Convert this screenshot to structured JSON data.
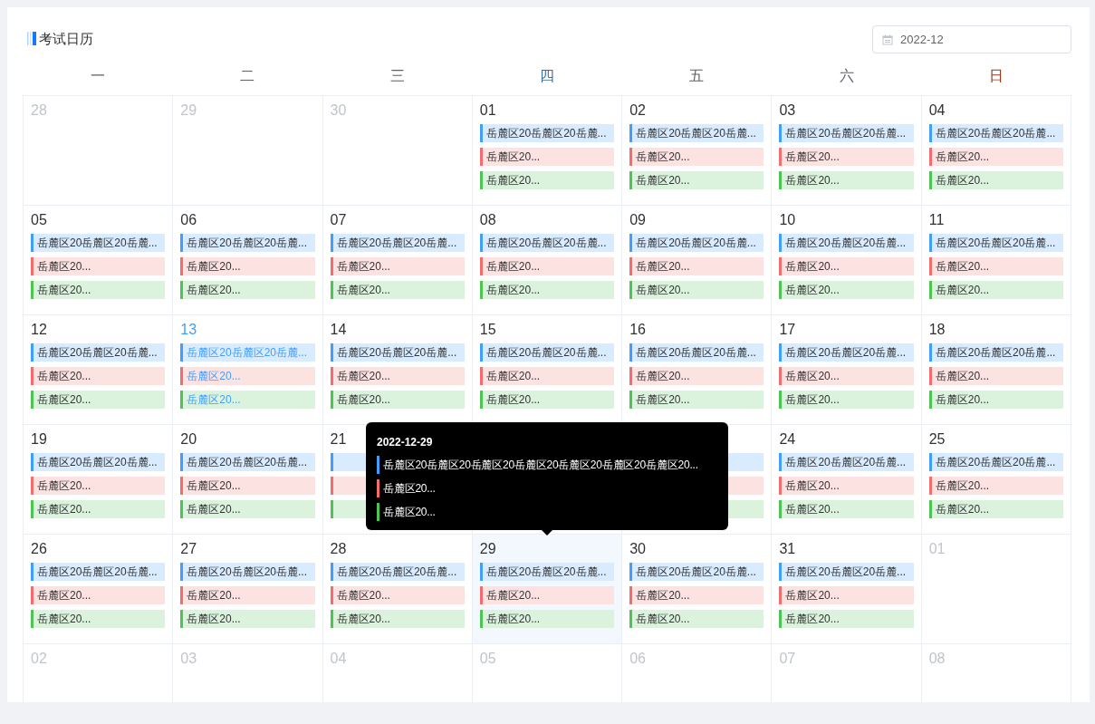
{
  "title": "考试日历",
  "date_picker": {
    "value": "2022-12"
  },
  "weekdays": [
    {
      "label": "一",
      "kind": "normal"
    },
    {
      "label": "二",
      "kind": "normal"
    },
    {
      "label": "三",
      "kind": "normal"
    },
    {
      "label": "四",
      "kind": "highlight"
    },
    {
      "label": "五",
      "kind": "normal"
    },
    {
      "label": "六",
      "kind": "normal"
    },
    {
      "label": "日",
      "kind": "weekend"
    }
  ],
  "weeks": [
    [
      {
        "day": "28",
        "kind": "other",
        "selected": false
      },
      {
        "day": "29",
        "kind": "other",
        "selected": false
      },
      {
        "day": "30",
        "kind": "other",
        "selected": false
      },
      {
        "day": "01",
        "kind": "current",
        "selected": false,
        "events": [
          {
            "text": "岳麓区20岳麓区20岳麓...",
            "kind": "primary"
          },
          {
            "text": "岳麓区20...",
            "kind": "danger"
          },
          {
            "text": "岳麓区20...",
            "kind": "success"
          }
        ]
      },
      {
        "day": "02",
        "kind": "current",
        "selected": false,
        "events": [
          {
            "text": "岳麓区20岳麓区20岳麓...",
            "kind": "primary"
          },
          {
            "text": "岳麓区20...",
            "kind": "danger"
          },
          {
            "text": "岳麓区20...",
            "kind": "success"
          }
        ]
      },
      {
        "day": "03",
        "kind": "current",
        "selected": false,
        "events": [
          {
            "text": "岳麓区20岳麓区20岳麓...",
            "kind": "primary"
          },
          {
            "text": "岳麓区20...",
            "kind": "danger"
          },
          {
            "text": "岳麓区20...",
            "kind": "success"
          }
        ]
      },
      {
        "day": "04",
        "kind": "current",
        "selected": false,
        "events": [
          {
            "text": "岳麓区20岳麓区20岳麓...",
            "kind": "primary"
          },
          {
            "text": "岳麓区20...",
            "kind": "danger"
          },
          {
            "text": "岳麓区20...",
            "kind": "success"
          }
        ]
      }
    ],
    [
      {
        "day": "05",
        "kind": "current",
        "selected": false,
        "events": [
          {
            "text": "岳麓区20岳麓区20岳麓...",
            "kind": "primary"
          },
          {
            "text": "岳麓区20...",
            "kind": "danger"
          },
          {
            "text": "岳麓区20...",
            "kind": "success"
          }
        ]
      },
      {
        "day": "06",
        "kind": "current",
        "selected": false,
        "events": [
          {
            "text": "岳麓区20岳麓区20岳麓...",
            "kind": "primary"
          },
          {
            "text": "岳麓区20...",
            "kind": "danger"
          },
          {
            "text": "岳麓区20...",
            "kind": "success"
          }
        ]
      },
      {
        "day": "07",
        "kind": "current",
        "selected": false,
        "events": [
          {
            "text": "岳麓区20岳麓区20岳麓...",
            "kind": "primary"
          },
          {
            "text": "岳麓区20...",
            "kind": "danger"
          },
          {
            "text": "岳麓区20...",
            "kind": "success"
          }
        ]
      },
      {
        "day": "08",
        "kind": "current",
        "selected": false,
        "events": [
          {
            "text": "岳麓区20岳麓区20岳麓...",
            "kind": "primary"
          },
          {
            "text": "岳麓区20...",
            "kind": "danger"
          },
          {
            "text": "岳麓区20...",
            "kind": "success"
          }
        ]
      },
      {
        "day": "09",
        "kind": "current",
        "selected": false,
        "events": [
          {
            "text": "岳麓区20岳麓区20岳麓...",
            "kind": "primary"
          },
          {
            "text": "岳麓区20...",
            "kind": "danger"
          },
          {
            "text": "岳麓区20...",
            "kind": "success"
          }
        ]
      },
      {
        "day": "10",
        "kind": "current",
        "selected": false,
        "events": [
          {
            "text": "岳麓区20岳麓区20岳麓...",
            "kind": "primary"
          },
          {
            "text": "岳麓区20...",
            "kind": "danger"
          },
          {
            "text": "岳麓区20...",
            "kind": "success"
          }
        ]
      },
      {
        "day": "11",
        "kind": "current",
        "selected": false,
        "events": [
          {
            "text": "岳麓区20岳麓区20岳麓...",
            "kind": "primary"
          },
          {
            "text": "岳麓区20...",
            "kind": "danger"
          },
          {
            "text": "岳麓区20...",
            "kind": "success"
          }
        ]
      }
    ],
    [
      {
        "day": "12",
        "kind": "current",
        "selected": false,
        "events": [
          {
            "text": "岳麓区20岳麓区20岳麓...",
            "kind": "primary"
          },
          {
            "text": "岳麓区20...",
            "kind": "danger"
          },
          {
            "text": "岳麓区20...",
            "kind": "success"
          }
        ]
      },
      {
        "day": "13",
        "kind": "today",
        "selected": false,
        "events": [
          {
            "text": "岳麓区20岳麓区20岳麓...",
            "kind": "primary"
          },
          {
            "text": "岳麓区20...",
            "kind": "danger"
          },
          {
            "text": "岳麓区20...",
            "kind": "success"
          }
        ]
      },
      {
        "day": "14",
        "kind": "current",
        "selected": false,
        "events": [
          {
            "text": "岳麓区20岳麓区20岳麓...",
            "kind": "primary"
          },
          {
            "text": "岳麓区20...",
            "kind": "danger"
          },
          {
            "text": "岳麓区20...",
            "kind": "success"
          }
        ]
      },
      {
        "day": "15",
        "kind": "current",
        "selected": false,
        "events": [
          {
            "text": "岳麓区20岳麓区20岳麓...",
            "kind": "primary"
          },
          {
            "text": "岳麓区20...",
            "kind": "danger"
          },
          {
            "text": "岳麓区20...",
            "kind": "success"
          }
        ]
      },
      {
        "day": "16",
        "kind": "current",
        "selected": false,
        "events": [
          {
            "text": "岳麓区20岳麓区20岳麓...",
            "kind": "primary"
          },
          {
            "text": "岳麓区20...",
            "kind": "danger"
          },
          {
            "text": "岳麓区20...",
            "kind": "success"
          }
        ]
      },
      {
        "day": "17",
        "kind": "current",
        "selected": false,
        "events": [
          {
            "text": "岳麓区20岳麓区20岳麓...",
            "kind": "primary"
          },
          {
            "text": "岳麓区20...",
            "kind": "danger"
          },
          {
            "text": "岳麓区20...",
            "kind": "success"
          }
        ]
      },
      {
        "day": "18",
        "kind": "current",
        "selected": false,
        "events": [
          {
            "text": "岳麓区20岳麓区20岳麓...",
            "kind": "primary"
          },
          {
            "text": "岳麓区20...",
            "kind": "danger"
          },
          {
            "text": "岳麓区20...",
            "kind": "success"
          }
        ]
      }
    ],
    [
      {
        "day": "19",
        "kind": "current",
        "selected": false,
        "events": [
          {
            "text": "岳麓区20岳麓区20岳麓...",
            "kind": "primary"
          },
          {
            "text": "岳麓区20...",
            "kind": "danger"
          },
          {
            "text": "岳麓区20...",
            "kind": "success"
          }
        ]
      },
      {
        "day": "20",
        "kind": "current",
        "selected": false,
        "events": [
          {
            "text": "岳麓区20岳麓区20岳麓...",
            "kind": "primary"
          },
          {
            "text": "岳麓区20...",
            "kind": "danger"
          },
          {
            "text": "岳麓区20...",
            "kind": "success"
          }
        ]
      },
      {
        "day": "21",
        "kind": "current",
        "selected": false,
        "events": [
          {
            "kind": "primary"
          },
          {
            "kind": "danger"
          },
          {
            "kind": "success"
          }
        ]
      },
      {
        "kind": "current"
      },
      {
        "kind": "current",
        "events": [
          {
            "kind": "primary"
          },
          {
            "kind": "danger"
          },
          {
            "kind": "success"
          }
        ]
      },
      {
        "day": "24",
        "kind": "current",
        "selected": false,
        "events": [
          {
            "text": "岳麓区20岳麓区20岳麓...",
            "kind": "primary"
          },
          {
            "text": "岳麓区20...",
            "kind": "danger"
          },
          {
            "text": "岳麓区20...",
            "kind": "success"
          }
        ]
      },
      {
        "day": "25",
        "kind": "current",
        "selected": false,
        "events": [
          {
            "text": "岳麓区20岳麓区20岳麓...",
            "kind": "primary"
          },
          {
            "text": "岳麓区20...",
            "kind": "danger"
          },
          {
            "text": "岳麓区20...",
            "kind": "success"
          }
        ]
      }
    ],
    [
      {
        "day": "26",
        "kind": "current",
        "selected": false,
        "events": [
          {
            "text": "岳麓区20岳麓区20岳麓...",
            "kind": "primary"
          },
          {
            "text": "岳麓区20...",
            "kind": "danger"
          },
          {
            "text": "岳麓区20...",
            "kind": "success"
          }
        ]
      },
      {
        "day": "27",
        "kind": "current",
        "selected": false,
        "events": [
          {
            "text": "岳麓区20岳麓区20岳麓...",
            "kind": "primary"
          },
          {
            "text": "岳麓区20...",
            "kind": "danger"
          },
          {
            "text": "岳麓区20...",
            "kind": "success"
          }
        ]
      },
      {
        "day": "28",
        "kind": "current",
        "selected": false,
        "events": [
          {
            "text": "岳麓区20岳麓区20岳麓...",
            "kind": "primary"
          },
          {
            "text": "岳麓区20...",
            "kind": "danger"
          },
          {
            "text": "岳麓区20...",
            "kind": "success"
          }
        ]
      },
      {
        "day": "29",
        "kind": "current",
        "selected": true,
        "events": [
          {
            "text": "岳麓区20岳麓区20岳麓...",
            "kind": "primary"
          },
          {
            "text": "岳麓区20...",
            "kind": "danger"
          },
          {
            "text": "岳麓区20...",
            "kind": "success"
          }
        ],
        "tooltip": {
          "title": "2022-12-29",
          "events": [
            {
              "text": "岳麓区20岳麓区20岳麓区20岳麓区20岳麓区20岳麓区20岳麓区20...",
              "kind": "primary"
            },
            {
              "text": "岳麓区20...",
              "kind": "danger"
            },
            {
              "text": "岳麓区20...",
              "kind": "success"
            }
          ]
        }
      },
      {
        "day": "30",
        "kind": "current",
        "selected": false,
        "events": [
          {
            "text": "岳麓区20岳麓区20岳麓...",
            "kind": "primary"
          },
          {
            "text": "岳麓区20...",
            "kind": "danger"
          },
          {
            "text": "岳麓区20...",
            "kind": "success"
          }
        ]
      },
      {
        "day": "31",
        "kind": "current",
        "selected": false,
        "events": [
          {
            "text": "岳麓区20岳麓区20岳麓...",
            "kind": "primary"
          },
          {
            "text": "岳麓区20...",
            "kind": "danger"
          },
          {
            "text": "岳麓区20...",
            "kind": "success"
          }
        ]
      },
      {
        "day": "01",
        "kind": "other",
        "selected": false
      }
    ],
    [
      {
        "day": "02",
        "kind": "other",
        "selected": false
      },
      {
        "day": "03",
        "kind": "other",
        "selected": false
      },
      {
        "day": "04",
        "kind": "other",
        "selected": false
      },
      {
        "day": "05",
        "kind": "other",
        "selected": false
      },
      {
        "day": "06",
        "kind": "other",
        "selected": false
      },
      {
        "day": "07",
        "kind": "other",
        "selected": false
      },
      {
        "day": "08",
        "kind": "other",
        "selected": false
      }
    ]
  ]
}
